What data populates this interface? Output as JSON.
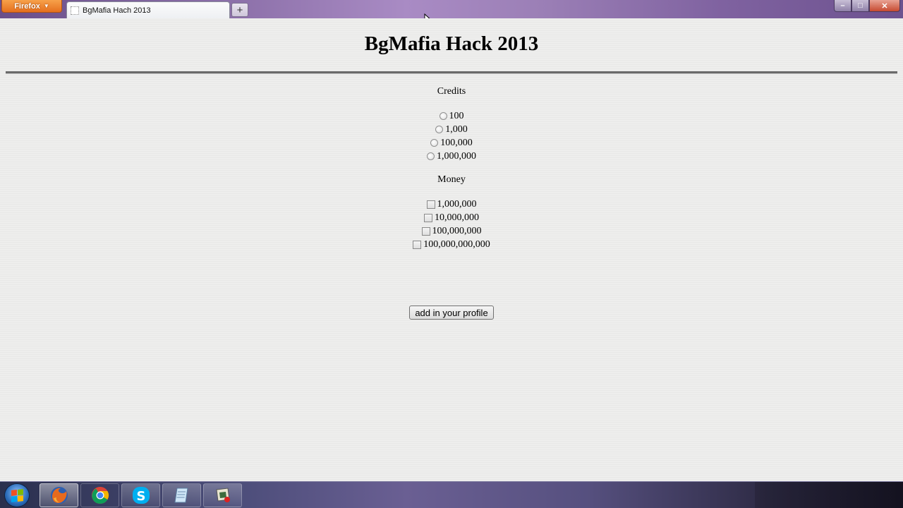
{
  "browser": {
    "menu_label": "Firefox",
    "tab_title": "BgMafia Hach 2013",
    "new_tab_symbol": "+",
    "window_controls": {
      "minimize": "–",
      "maximize": "□",
      "close": "✕"
    }
  },
  "page": {
    "title": "BgMafia Hack 2013",
    "credits": {
      "label": "Credits",
      "options": [
        "100",
        "1,000",
        "100,000",
        "1,000,000"
      ]
    },
    "money": {
      "label": "Money",
      "options": [
        "1,000,000",
        "10,000,000",
        "100,000,000",
        "100,000,000,000"
      ]
    },
    "submit_label": "add in your profile"
  },
  "taskbar": {
    "items": [
      {
        "icon": "firefox-icon",
        "state": "active"
      },
      {
        "icon": "chrome-icon",
        "state": "idle"
      },
      {
        "icon": "skype-icon",
        "state": "running"
      },
      {
        "icon": "notepad-icon",
        "state": "running"
      },
      {
        "icon": "recorder-icon",
        "state": "running"
      }
    ]
  },
  "colors": {
    "accent_orange": "#e5701e",
    "page_background": "#ececeb",
    "rule": "#6a6a6a"
  }
}
